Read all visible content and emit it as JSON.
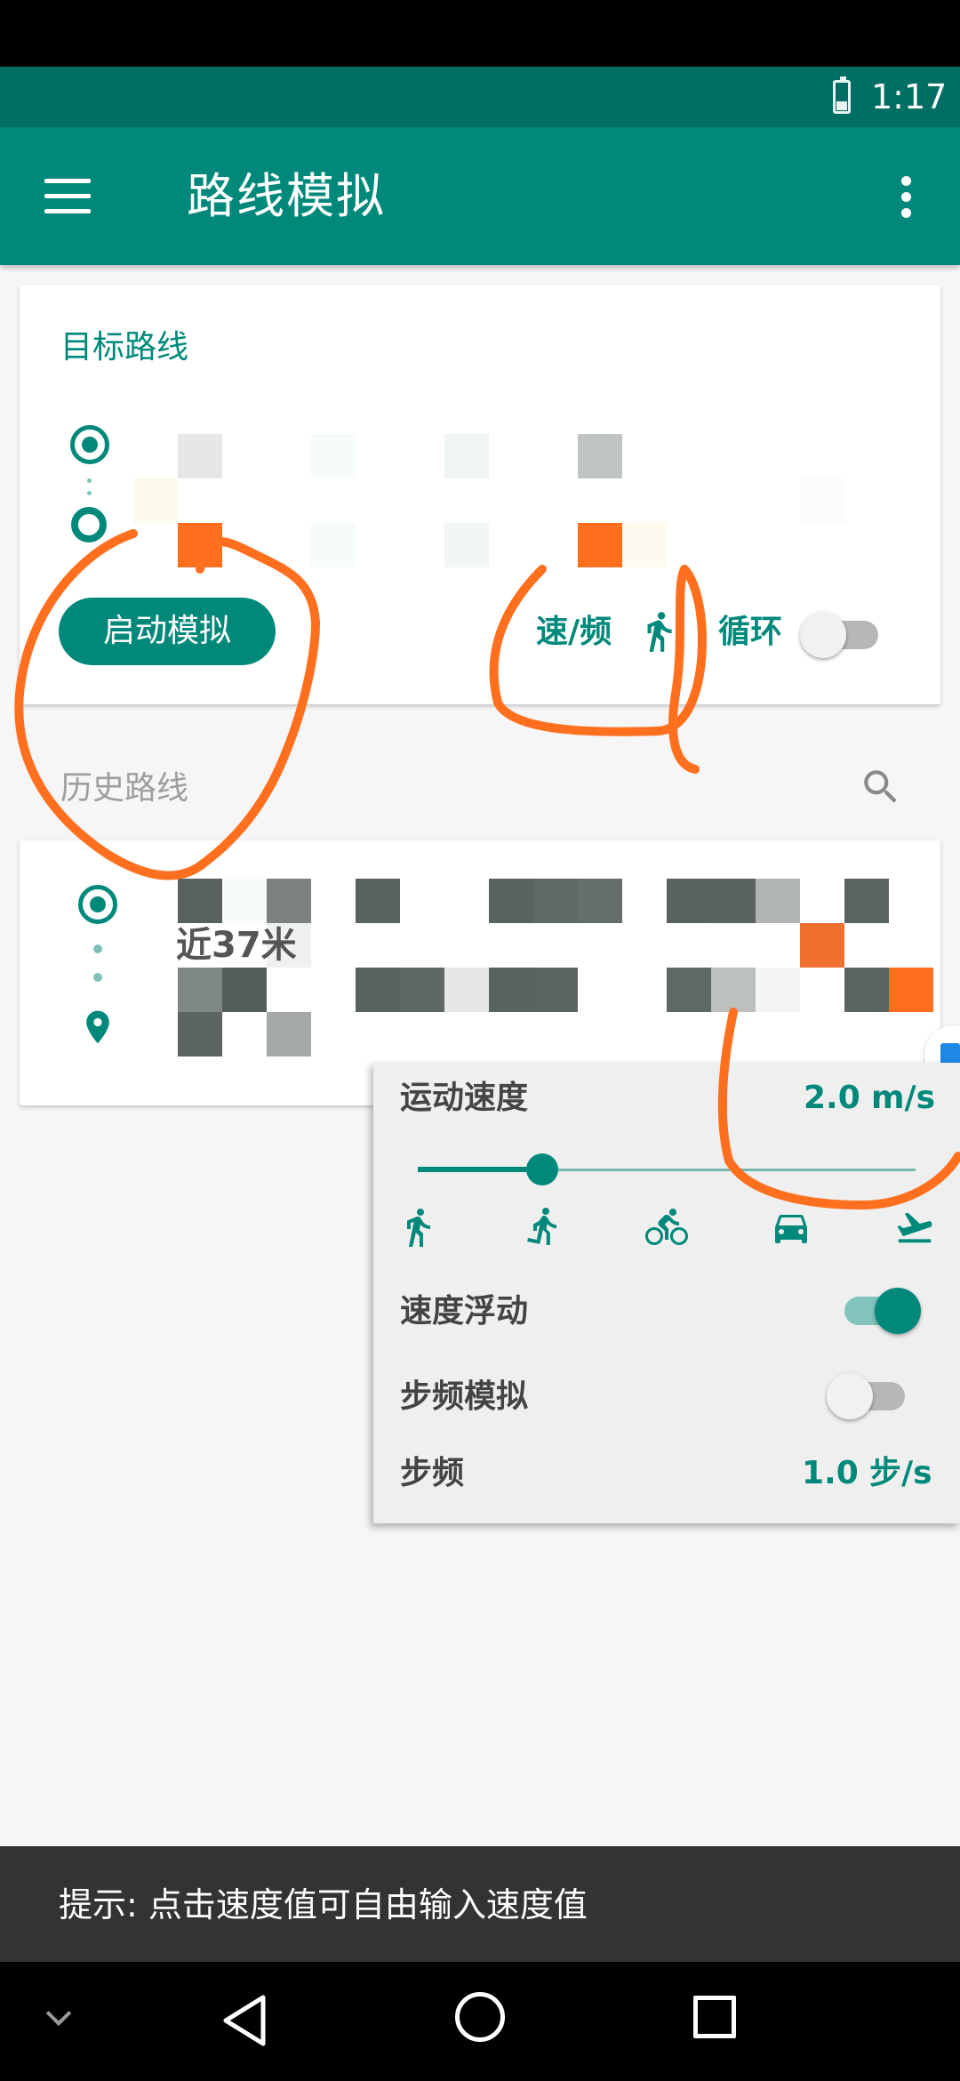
{
  "status_bar": {
    "time": "1:17",
    "battery_icon": "battery-icon"
  },
  "app_bar": {
    "title": "路线模拟",
    "menu_icon": "hamburger-menu-icon",
    "more_icon": "more-vert-icon"
  },
  "target_route": {
    "title": "目标路线",
    "start_button": "启动模拟",
    "speed_label": "速/频",
    "speed_icon": "running-person-icon",
    "loop_label": "循环",
    "loop_on": false
  },
  "history": {
    "title": "历史路线",
    "search_icon": "search-icon",
    "items": [
      {
        "distance": "近37米"
      }
    ]
  },
  "speed_panel": {
    "speed_label": "运动速度",
    "speed_value": "2.0",
    "speed_unit": "m/s",
    "slider_fraction": 0.17,
    "modes": [
      "walk-icon",
      "run-icon",
      "bicycle-icon",
      "car-icon",
      "airplane-icon"
    ],
    "float_label": "速度浮动",
    "float_on": true,
    "cadence_label": "步频模拟",
    "cadence_on": false,
    "step_label": "步频",
    "step_value": "1.0",
    "step_unit": "步/s"
  },
  "snackbar": {
    "text": "提示: 点击速度值可自由输入速度值"
  },
  "colors": {
    "primary": "#00897b",
    "primary_dark": "#006e63",
    "annotation": "#ff6f1e"
  }
}
